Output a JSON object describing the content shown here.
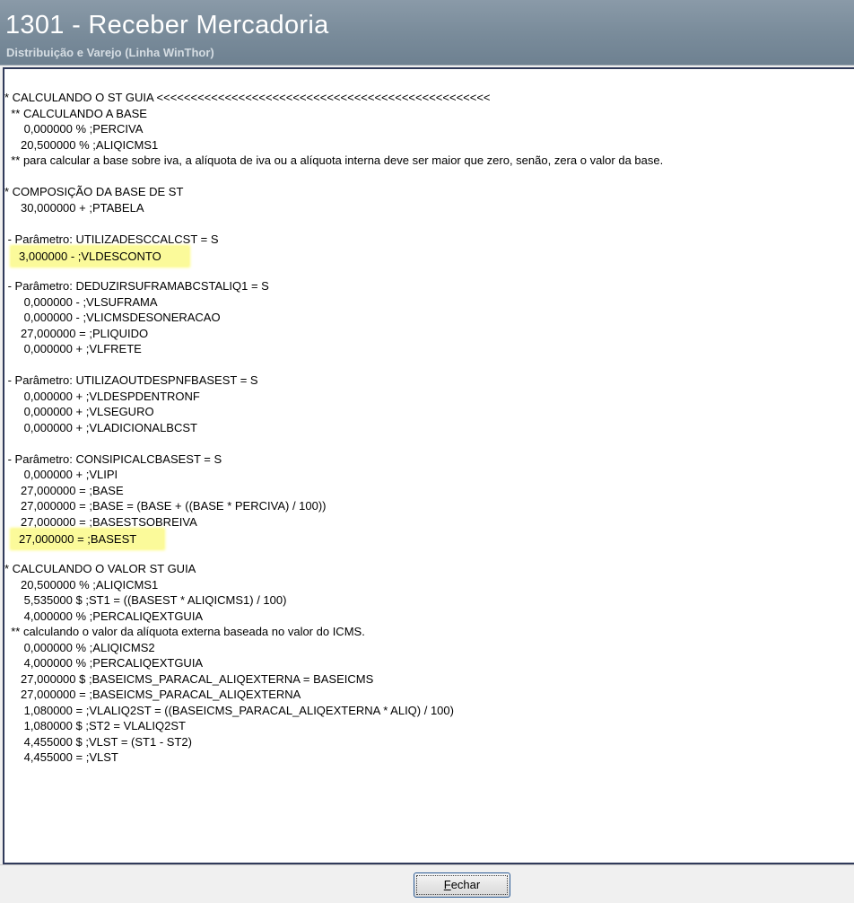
{
  "window": {
    "title": "1301 - Receber Mercadoria",
    "subtitle": "Distribuição e Varejo (Linha WinThor)"
  },
  "log_lines": [
    "* CALCULANDO O ST GUIA <<<<<<<<<<<<<<<<<<<<<<<<<<<<<<<<<<<<<<<<<<<<<<<<<",
    "  ** CALCULANDO A BASE",
    "      0,000000 % ;PERCIVA",
    "     20,500000 % ;ALIQICMS1",
    "  ** para calcular a base sobre iva, a alíquota de iva ou a alíquota interna deve ser maior que zero, senão, zera o valor da base.",
    "",
    "* COMPOSIÇÃO DA BASE DE ST",
    "     30,000000 + ;PTABELA",
    "",
    " - Parâmetro: UTILIZADESCCALCST = S",
    "      3,000000 - ;VLDESCONTO",
    "",
    " - Parâmetro: DEDUZIRSUFRAMABCSTALIQ1 = S",
    "      0,000000 - ;VLSUFRAMA",
    "      0,000000 - ;VLICMSDESONERACAO",
    "     27,000000 = ;PLIQUIDO",
    "      0,000000 + ;VLFRETE",
    "",
    " - Parâmetro: UTILIZAOUTDESPNFBASEST = S",
    "      0,000000 + ;VLDESPDENTRONF",
    "      0,000000 + ;VLSEGURO",
    "      0,000000 + ;VLADICIONALBCST",
    "",
    " - Parâmetro: CONSIPICALCBASEST = S",
    "      0,000000 + ;VLIPI",
    "     27,000000 = ;BASE",
    "     27,000000 = ;BASE = (BASE + ((BASE * PERCIVA) / 100))",
    "     27,000000 = ;BASESTSOBREIVA",
    "     27,000000 = ;BASEST",
    "",
    "* CALCULANDO O VALOR ST GUIA",
    "     20,500000 % ;ALIQICMS1",
    "      5,535000 $ ;ST1 = ((BASEST * ALIQICMS1) / 100)",
    "      4,000000 % ;PERCALIQEXTGUIA",
    "  ** calculando o valor da alíquota externa baseada no valor do ICMS.",
    "      0,000000 % ;ALIQICMS2",
    "      4,000000 % ;PERCALIQEXTGUIA",
    "     27,000000 $ ;BASEICMS_PARACAL_ALIQEXTERNA = BASEICMS",
    "     27,000000 = ;BASEICMS_PARACAL_ALIQEXTERNA",
    "      1,080000 = ;VLALIQ2ST = ((BASEICMS_PARACAL_ALIQEXTERNA * ALIQ) / 100)",
    "      1,080000 $ ;ST2 = VLALIQ2ST",
    "      4,455000 $ ;VLST = (ST1 - ST2)",
    "      4,455000 = ;VLST"
  ],
  "highlighted_lines": [
    10,
    28
  ],
  "highlight_color": "#fbfa9a",
  "buttons": {
    "close_prefix": "F",
    "close_rest": "echar"
  }
}
